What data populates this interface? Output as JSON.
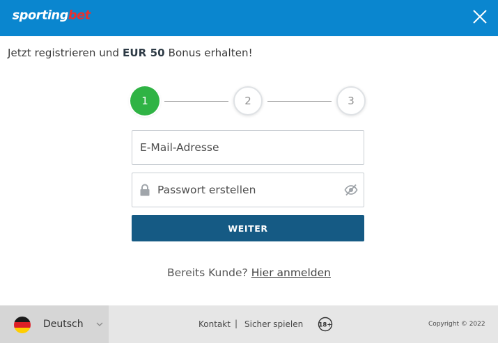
{
  "header": {
    "logo_text": "sportingbet",
    "colors": {
      "background": "#0a86cf",
      "logo_primary": "#ffffff",
      "logo_accent": "#e8312f"
    }
  },
  "promo": {
    "prefix": "Jetzt registrieren und ",
    "bonus": "EUR 50",
    "suffix": " Bonus erhalten!"
  },
  "stepper": {
    "steps": [
      "1",
      "2",
      "3"
    ],
    "active_step": 1,
    "active_color": "#2fb344"
  },
  "form": {
    "email_placeholder": "E-Mail-Adresse",
    "password_placeholder": "Passwort erstellen",
    "submit_label": "WEITER",
    "submit_color": "#155a84"
  },
  "login": {
    "prompt": "Bereits Kunde? ",
    "link": "Hier anmelden"
  },
  "footer": {
    "language": "Deutsch",
    "links": [
      "Kontakt",
      "Sicher spielen"
    ],
    "separator": "|",
    "age_badge": "18+",
    "copyright": "Copyright © 2022"
  },
  "icons": [
    "close-icon",
    "lock-icon",
    "eye-slash-icon",
    "germany-flag-icon",
    "chevron-down-icon",
    "age-18-plus-icon"
  ]
}
